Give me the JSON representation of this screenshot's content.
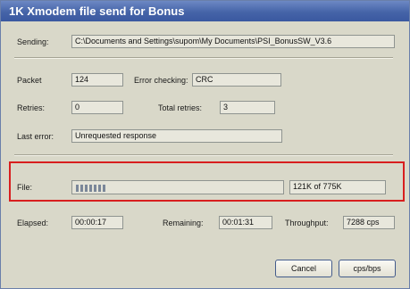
{
  "window": {
    "title": "1K Xmodem file send for Bonus"
  },
  "sending": {
    "label": "Sending:",
    "value": "C:\\Documents and Settings\\supom\\My Documents\\PSI_BonusSW_V3.6"
  },
  "packet": {
    "label": "Packet",
    "value": "124"
  },
  "error_checking": {
    "label": "Error checking:",
    "value": "CRC"
  },
  "retries": {
    "label": "Retries:",
    "value": "0"
  },
  "total_retries": {
    "label": "Total retries:",
    "value": "3"
  },
  "last_error": {
    "label": "Last error:",
    "value": "Unrequested response"
  },
  "file": {
    "label": "File:",
    "progress_fraction": 0.16,
    "size_text": "121K of 775K"
  },
  "elapsed": {
    "label": "Elapsed:",
    "value": "00:00:17"
  },
  "remaining": {
    "label": "Remaining:",
    "value": "00:01:31"
  },
  "throughput": {
    "label": "Throughput:",
    "value": "7288 cps"
  },
  "buttons": {
    "cancel": "Cancel",
    "cps_bps": "cps/bps"
  },
  "colors": {
    "title_bar": "#4564a8",
    "dialog_bg": "#d9d8c9",
    "highlight_border": "#d81e1e"
  }
}
